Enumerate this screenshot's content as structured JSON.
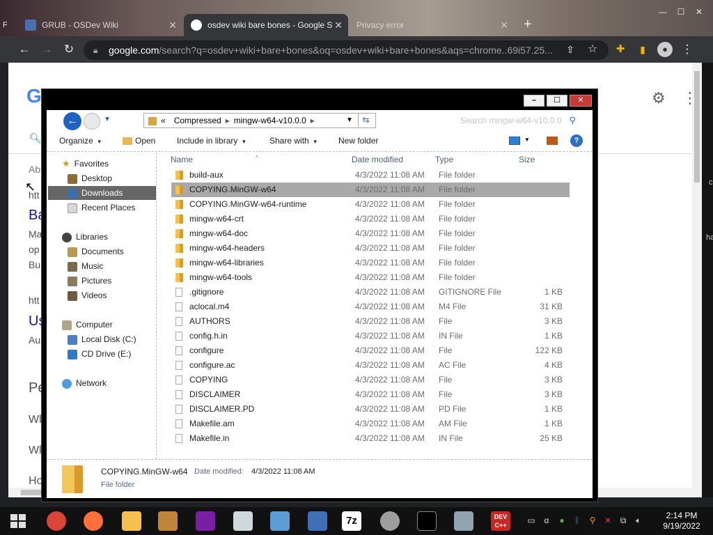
{
  "chrome": {
    "tabs": [
      {
        "title": "GRUB - OSDev Wiki",
        "icon_color": "#4a6fb0"
      },
      {
        "title": "osdev wiki bare bones - Google S",
        "icon_color": "#ffffff"
      },
      {
        "title": "Privacy error",
        "icon_color": "#ffffff"
      }
    ],
    "left_edge_label": "F",
    "new_tab": "+",
    "url_domain": "google.com",
    "url_path": "/search?q=osdev+wiki+bare+bones&oq=osdev+wiki+bare+bones&aqs=chrome..69i57.25...",
    "google_logo": "G",
    "background_texts": [
      "Ab",
      "htt",
      "Ba",
      "Ma",
      "op",
      "Bu",
      "htt",
      "Us",
      "Au",
      "Pe",
      "Wl",
      "Wl",
      "Ho"
    ],
    "right_strip_texts": [
      "c",
      "ha"
    ]
  },
  "explorer": {
    "breadcrumb": [
      "Compressed",
      "mingw-w64-v10.0.0"
    ],
    "breadcrumb_prefix": "«",
    "search_placeholder": "Search mingw-w64-v10.0.0",
    "commands": {
      "organize": "Organize",
      "open": "Open",
      "include_in_library": "Include in library",
      "share_with": "Share with",
      "new_folder": "New folder"
    },
    "nav": {
      "favorites": "Favorites",
      "desktop": "Desktop",
      "downloads": "Downloads",
      "recent_places": "Recent Places",
      "libraries": "Libraries",
      "documents": "Documents",
      "music": "Music",
      "pictures": "Pictures",
      "videos": "Videos",
      "computer": "Computer",
      "local_disk": "Local Disk (C:)",
      "cd_drive": "CD Drive (E:)",
      "network": "Network"
    },
    "columns": {
      "name": "Name",
      "date": "Date modified",
      "type": "Type",
      "size": "Size"
    },
    "files": [
      {
        "name": "build-aux",
        "date": "4/3/2022 11:08 AM",
        "type": "File folder",
        "size": "",
        "kind": "folder"
      },
      {
        "name": "COPYING.MinGW-w64",
        "date": "4/3/2022 11:08 AM",
        "type": "File folder",
        "size": "",
        "kind": "folder",
        "selected": true
      },
      {
        "name": "COPYING.MinGW-w64-runtime",
        "date": "4/3/2022 11:08 AM",
        "type": "File folder",
        "size": "",
        "kind": "folder"
      },
      {
        "name": "mingw-w64-crt",
        "date": "4/3/2022 11:08 AM",
        "type": "File folder",
        "size": "",
        "kind": "folder"
      },
      {
        "name": "mingw-w64-doc",
        "date": "4/3/2022 11:08 AM",
        "type": "File folder",
        "size": "",
        "kind": "folder"
      },
      {
        "name": "mingw-w64-headers",
        "date": "4/3/2022 11:08 AM",
        "type": "File folder",
        "size": "",
        "kind": "folder"
      },
      {
        "name": "mingw-w64-libraries",
        "date": "4/3/2022 11:08 AM",
        "type": "File folder",
        "size": "",
        "kind": "folder"
      },
      {
        "name": "mingw-w64-tools",
        "date": "4/3/2022 11:08 AM",
        "type": "File folder",
        "size": "",
        "kind": "folder"
      },
      {
        "name": ".gitignore",
        "date": "4/3/2022 11:08 AM",
        "type": "GITIGNORE File",
        "size": "1 KB",
        "kind": "file"
      },
      {
        "name": "aclocal.m4",
        "date": "4/3/2022 11:08 AM",
        "type": "M4 File",
        "size": "31 KB",
        "kind": "file"
      },
      {
        "name": "AUTHORS",
        "date": "4/3/2022 11:08 AM",
        "type": "File",
        "size": "3 KB",
        "kind": "file"
      },
      {
        "name": "config.h.in",
        "date": "4/3/2022 11:08 AM",
        "type": "IN File",
        "size": "1 KB",
        "kind": "file"
      },
      {
        "name": "configure",
        "date": "4/3/2022 11:08 AM",
        "type": "File",
        "size": "122 KB",
        "kind": "file"
      },
      {
        "name": "configure.ac",
        "date": "4/3/2022 11:08 AM",
        "type": "AC File",
        "size": "4 KB",
        "kind": "file"
      },
      {
        "name": "COPYING",
        "date": "4/3/2022 11:08 AM",
        "type": "File",
        "size": "3 KB",
        "kind": "file"
      },
      {
        "name": "DISCLAIMER",
        "date": "4/3/2022 11:08 AM",
        "type": "File",
        "size": "3 KB",
        "kind": "file"
      },
      {
        "name": "DISCLAIMER.PD",
        "date": "4/3/2022 11:08 AM",
        "type": "PD File",
        "size": "1 KB",
        "kind": "file"
      },
      {
        "name": "Makefile.am",
        "date": "4/3/2022 11:08 AM",
        "type": "AM File",
        "size": "1 KB",
        "kind": "file"
      },
      {
        "name": "Makefile.in",
        "date": "4/3/2022 11:08 AM",
        "type": "IN File",
        "size": "25 KB",
        "kind": "file"
      }
    ],
    "details": {
      "name": "COPYING.MinGW-w64",
      "modified_label": "Date modified:",
      "modified_value": "4/3/2022 11:08 AM",
      "type": "File folder"
    }
  },
  "taskbar": {
    "apps": [
      {
        "icon": "chrome-icon",
        "color": "#db4437"
      },
      {
        "icon": "firefox-icon",
        "color": "#ff7139"
      },
      {
        "icon": "file-explorer-icon",
        "color": "#f4c04e"
      },
      {
        "icon": "paint-icon",
        "color": "#c0843a"
      },
      {
        "icon": "yahoo-messenger-icon",
        "color": "#7b1fa2"
      },
      {
        "icon": "mixer-icon",
        "color": "#cfd8dc"
      },
      {
        "icon": "resource-monitor-icon",
        "color": "#5d9bd5"
      },
      {
        "icon": "network-tool-icon",
        "color": "#3f6fb5"
      },
      {
        "icon": "7zip-icon",
        "color": "#ffffff"
      },
      {
        "icon": "dvd-icon",
        "color": "#9e9e9e"
      },
      {
        "icon": "command-prompt-icon",
        "color": "#000000"
      },
      {
        "icon": "calculator-icon",
        "color": "#90a4ae"
      },
      {
        "icon": "dev-cpp-icon",
        "color": "#c62828"
      }
    ],
    "sevenzip_label": "7z",
    "devcpp_label": "DEV C++",
    "time": "2:14 PM",
    "date": "9/19/2022"
  }
}
